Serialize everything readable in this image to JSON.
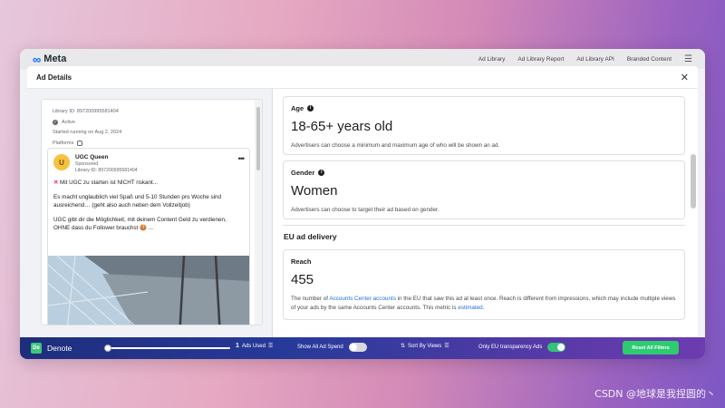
{
  "header": {
    "logo": "Meta",
    "nav": [
      "Ad Library",
      "Ad Library Report",
      "Ad Library API",
      "Branded Content"
    ]
  },
  "modal": {
    "title": "Ad Details",
    "close": "✕"
  },
  "ad": {
    "library_id": "Library ID: 897200995581404",
    "status": "Active",
    "started": "Started running on Aug 2, 2024",
    "platforms_label": "Platforms",
    "page_name": "UGC Queen",
    "sponsored": "Sponsored",
    "card_library_id": "Library ID: 897200995581404",
    "avatar_letter": "U",
    "text_1": "Mit UGC zu starten ist NICHT riskant...",
    "text_2": "Es macht unglaublich viel Spaß und 5-10 Stunden pro Woche sind ausreichend… (geht also auch neben dem Vollzeitjob)",
    "text_3": "UGC gibt dir die Möglichkeit, mit deinem Content Geld zu verdienen, OHNE dass du Follower brauchst 🍪 ..."
  },
  "details": {
    "age_label": "Age",
    "age_value": "18-65+ years old",
    "age_desc": "Advertisers can choose a minimum and maximum age of who will be shown an ad.",
    "gender_label": "Gender",
    "gender_value": "Women",
    "gender_desc": "Advertisers can choose to target their ad based on gender.",
    "eu_title": "EU ad delivery",
    "reach_label": "Reach",
    "reach_value": "455",
    "reach_desc_1": "The number of",
    "reach_link_1": "Accounts Center accounts",
    "reach_desc_2": "in the EU that saw this ad at least once. Reach is different from impressions, which may include multiple views of your ads by the same Accounts Center accounts. This metric is",
    "reach_link_2": "estimated",
    "reach_desc_3": "."
  },
  "toolbar": {
    "app_name": "Denote",
    "app_icon": "De",
    "ads_used_count": "1",
    "ads_used_label": "Ads Used",
    "show_spend_label": "Show All Ad Spend",
    "show_spend_on": false,
    "sort_label": "Sort By Views",
    "eu_only_label": "Only EU transparency Ads",
    "eu_only_on": true,
    "reset_label": "Reset All Filters"
  },
  "watermark": "CSDN @地球是我捏圆的丶"
}
